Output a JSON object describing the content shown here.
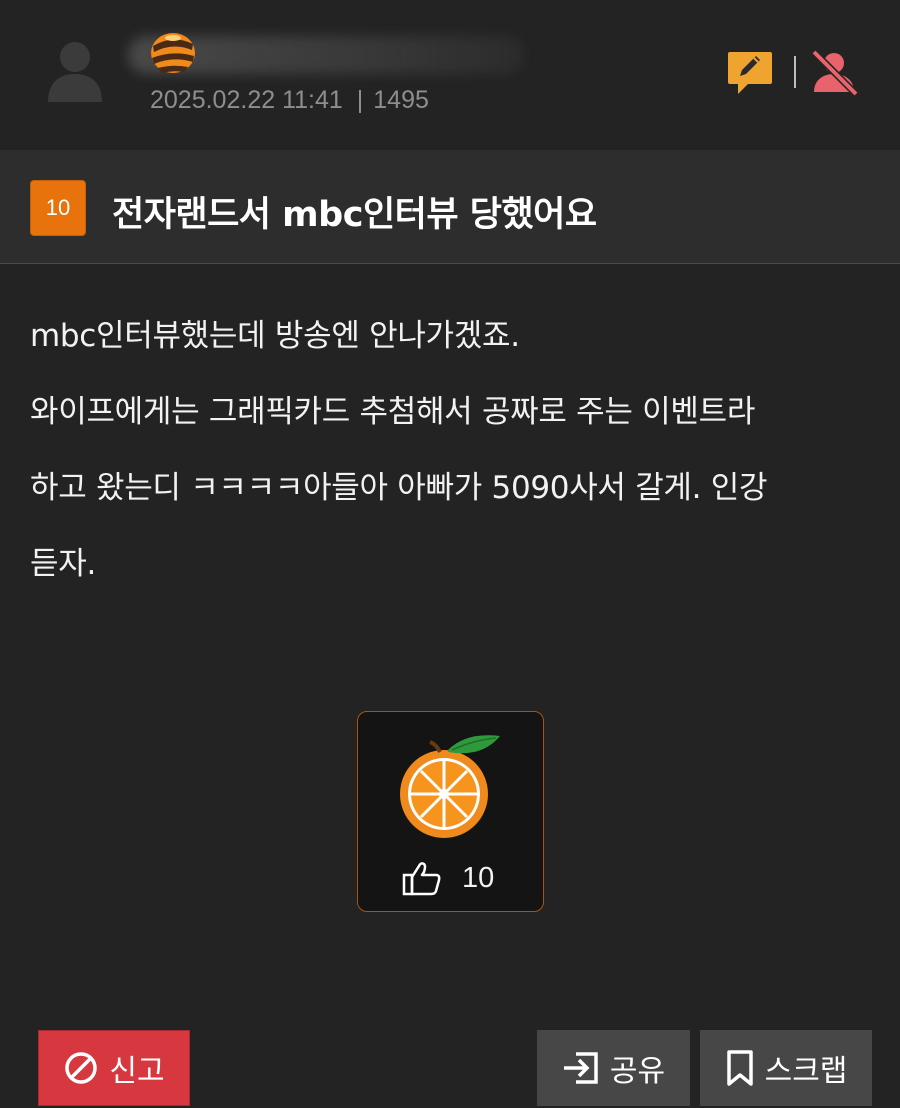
{
  "header": {
    "meta_date": "2025.02.22 11:41",
    "meta_separator": "|",
    "meta_views": "1495",
    "icons": {
      "avatar": "user-silhouette-icon",
      "edit": "pencil-speech-icon",
      "block": "user-blocked-icon"
    }
  },
  "post": {
    "vote_count": "10",
    "title": "전자랜드서 mbc인터뷰 당했어요",
    "body_lines": [
      "mbc인터뷰했는데 방송엔 안나가겠죠.",
      "와이프에게는 그래픽카드 추첨해서 공짜로 주는 이벤트라",
      "하고 왔는디 ㅋㅋㅋㅋ아들아 아빠가 5090사서 갈게. 인강",
      "듣자."
    ]
  },
  "recommend": {
    "count": "10",
    "icons": {
      "fruit": "orange-icon",
      "like": "thumbs-up-icon"
    }
  },
  "actions": {
    "report_label": "신고",
    "share_label": "공유",
    "scrap_label": "스크랩"
  },
  "colors": {
    "background": "#232323",
    "title_bar": "#2d2d2d",
    "accent_orange": "#e8720c",
    "report_red": "#d7383f",
    "button_gray": "#474747"
  }
}
